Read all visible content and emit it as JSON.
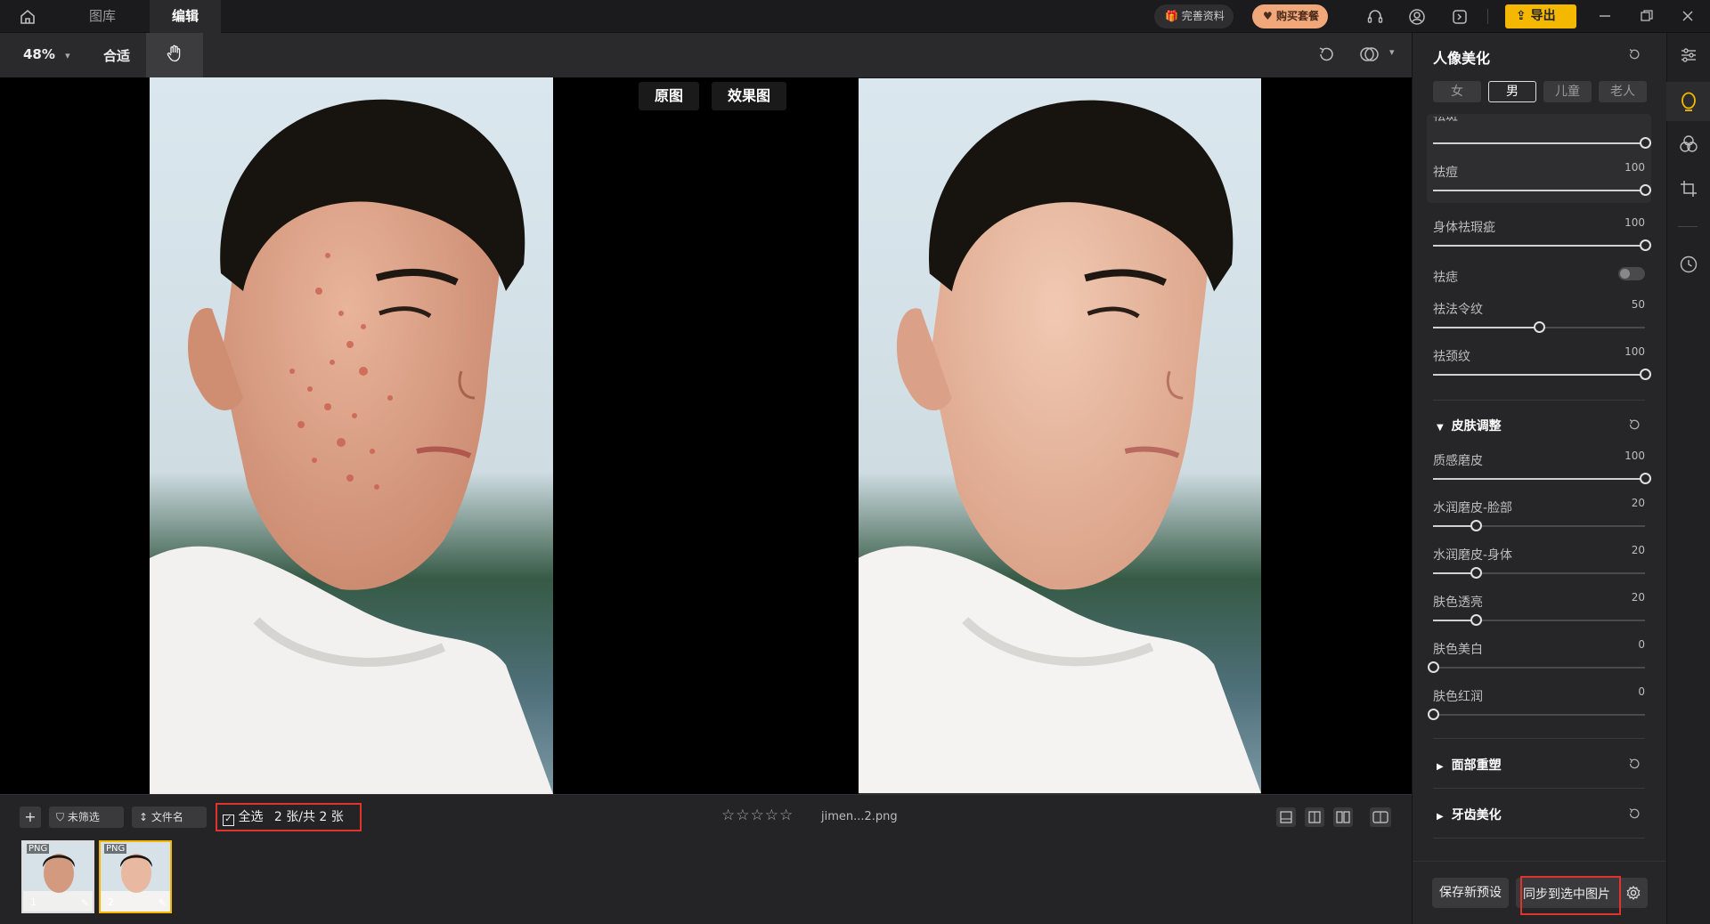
{
  "titlebar": {
    "tabs": [
      {
        "label": "图库",
        "active": false
      },
      {
        "label": "编辑",
        "active": true
      }
    ],
    "gift_label": "完善资料",
    "buy_label": "购买套餐",
    "export_label": "导出"
  },
  "toolbar": {
    "zoom": "48%",
    "fit_label": "合适"
  },
  "compare": {
    "original_label": "原图",
    "effect_label": "效果图"
  },
  "bottombar": {
    "add_label": "+",
    "filter_label": "未筛选",
    "sort_label": "文件名",
    "select_all_label": "全选",
    "count_label": "2 张/共 2 张",
    "filename": "jimen...2.png",
    "stars": "☆☆☆☆☆",
    "thumbnails": [
      {
        "format": "PNG",
        "index": "1"
      },
      {
        "format": "PNG",
        "index": "2"
      }
    ]
  },
  "panel": {
    "title": "人像美化",
    "genders": [
      "女",
      "男",
      "儿童",
      "老人"
    ],
    "active_gender": "男",
    "clipped_label": "祛斑",
    "clipped_value": "100",
    "group1": [
      {
        "label": "祛痘",
        "value": "100",
        "fraction": 1.0
      }
    ],
    "body_items": [
      {
        "label": "身体祛瑕疵",
        "value": "100",
        "fraction": 1.0
      }
    ],
    "toggle_label": "祛痣",
    "group2": [
      {
        "label": "祛法令纹",
        "value": "50",
        "fraction": 0.5
      },
      {
        "label": "祛颈纹",
        "value": "100",
        "fraction": 1.0
      }
    ],
    "skin_section": "皮肤调整",
    "skin_items": [
      {
        "label": "质感磨皮",
        "value": "100",
        "fraction": 1.0
      },
      {
        "label": "水润磨皮-脸部",
        "value": "20",
        "fraction": 0.2
      },
      {
        "label": "水润磨皮-身体",
        "value": "20",
        "fraction": 0.2
      },
      {
        "label": "肤色透亮",
        "value": "20",
        "fraction": 0.2
      },
      {
        "label": "肤色美白",
        "value": "0",
        "fraction": 0.0
      },
      {
        "label": "肤色红润",
        "value": "0",
        "fraction": 0.0
      }
    ],
    "face_section": "面部重塑",
    "teeth_section": "牙齿美化",
    "save_preset_label": "保存新预设",
    "sync_label": "同步到选中图片"
  },
  "colors": {
    "accent_yellow": "#f5b800",
    "highlight_red": "#e0332c",
    "buy_orange": "#f0a77a"
  }
}
